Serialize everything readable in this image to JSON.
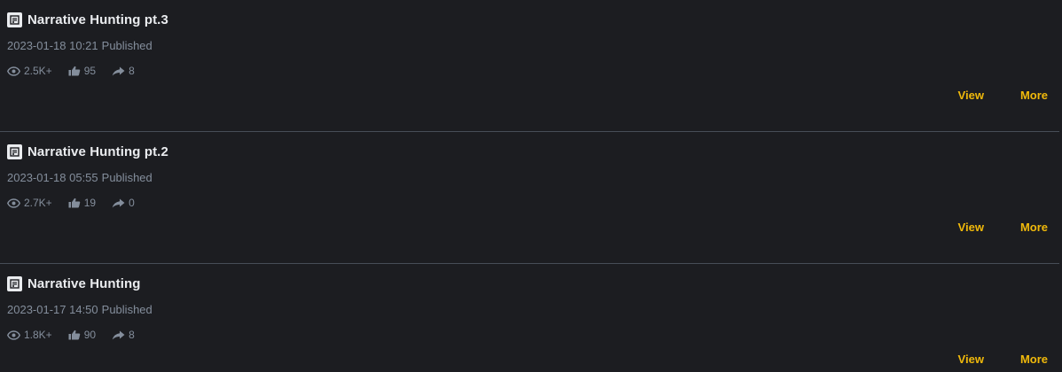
{
  "articles": [
    {
      "title": "Narrative Hunting pt.3",
      "date": "2023-01-18 10:21",
      "status": "Published",
      "views": "2.5K+",
      "likes": "95",
      "shares": "8",
      "view_label": "View",
      "more_label": "More"
    },
    {
      "title": "Narrative Hunting pt.2",
      "date": "2023-01-18 05:55",
      "status": "Published",
      "views": "2.7K+",
      "likes": "19",
      "shares": "0",
      "view_label": "View",
      "more_label": "More"
    },
    {
      "title": "Narrative Hunting",
      "date": "2023-01-17 14:50",
      "status": "Published",
      "views": "1.8K+",
      "likes": "90",
      "shares": "8",
      "view_label": "View",
      "more_label": "More"
    }
  ],
  "icons": {
    "doc": "document-icon",
    "views": "eye-icon",
    "likes": "thumbs-up-icon",
    "shares": "share-arrow-icon"
  },
  "colors": {
    "background": "#1c1d21",
    "title": "#eaecef",
    "secondary": "#848e9c",
    "accent": "#f0b90b",
    "divider": "#474d57"
  }
}
